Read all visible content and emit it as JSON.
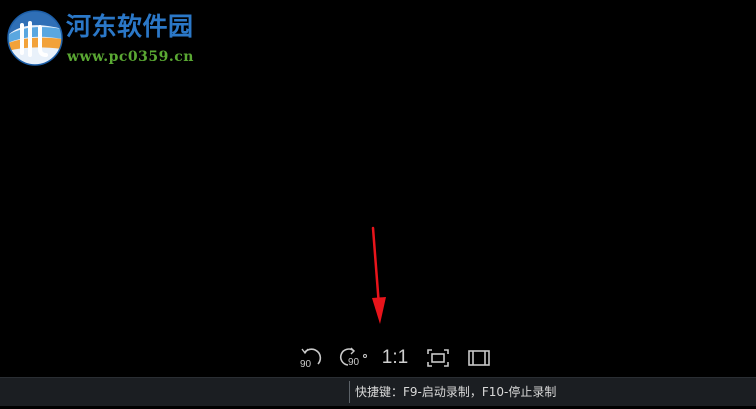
{
  "watermark": {
    "title": "河东软件园",
    "url": "www.pc0359.cn",
    "logo_icon": "hedong-logo-icon",
    "title_color": "#2b78c8",
    "url_color": "#5aa833"
  },
  "annotation": {
    "arrow_icon": "red-arrow-icon",
    "color": "#e8141b"
  },
  "controls": {
    "rotate_ccw": {
      "icon": "rotate-ccw-90-icon",
      "label": "90"
    },
    "rotate_cw": {
      "icon": "rotate-cw-90-icon",
      "label": "90"
    },
    "ratio_label": "1:1",
    "fit_icon": "fit-window-icon",
    "fullscreen_icon": "fullscreen-icon",
    "color": "#c9c9c9"
  },
  "statusbar": {
    "hint": "快捷键：F9-启动录制，F10-停止录制",
    "background": "#1b1e22"
  }
}
